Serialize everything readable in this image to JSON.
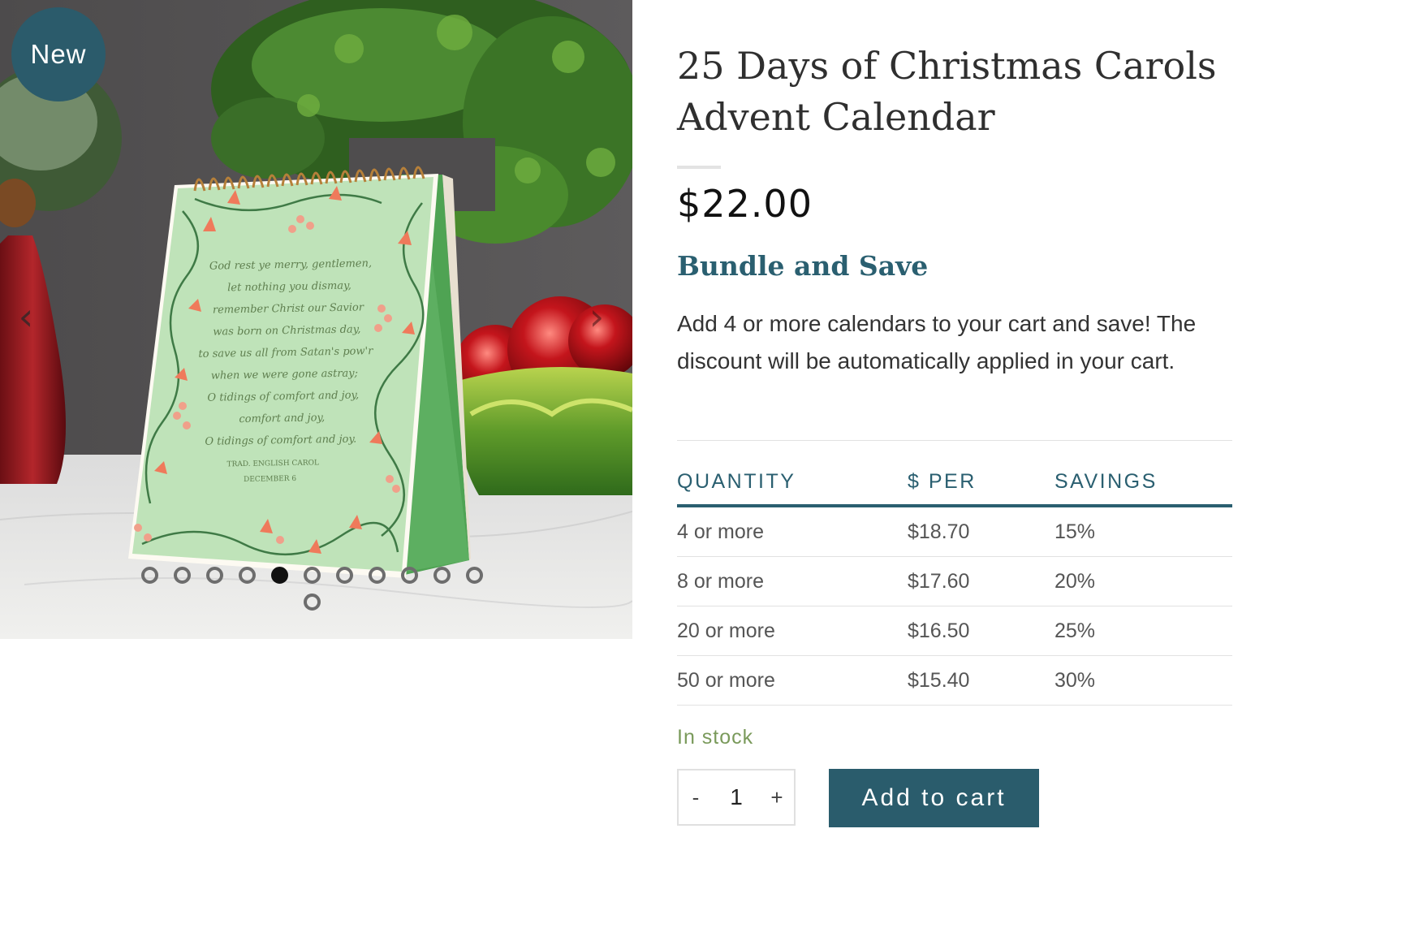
{
  "gallery": {
    "badge": "New",
    "prev_icon": "chevron-left-icon",
    "next_icon": "chevron-right-icon",
    "dot_count": 12,
    "active_dot_index": 4,
    "card_text": {
      "lines": [
        "God rest ye merry, gentlemen,",
        "let nothing you dismay,",
        "remember Christ our Savior",
        "was born on Christmas day,",
        "to save us all from Satan's pow'r",
        "when we were gone astray;",
        "O tidings of comfort and joy,",
        "comfort and joy,",
        "O tidings of comfort and joy."
      ],
      "attribution": "TRAD. ENGLISH CAROL",
      "date": "DECEMBER 6"
    }
  },
  "product": {
    "title": "25 Days of Christmas Carols Advent Calendar",
    "price": "$22.00",
    "bundle_heading": "Bundle and Save",
    "bundle_text": "Add 4 or more calendars to your cart and save! The discount will be automatically applied in your cart.",
    "stock": "In stock"
  },
  "tiers": {
    "headers": [
      "QUANTITY",
      "$ PER",
      "SAVINGS"
    ],
    "rows": [
      [
        "4 or more",
        "$18.70",
        "15%"
      ],
      [
        "8 or more",
        "$17.60",
        "20%"
      ],
      [
        "20 or more",
        "$16.50",
        "25%"
      ],
      [
        "50 or more",
        "$15.40",
        "30%"
      ]
    ]
  },
  "cart": {
    "minus": "-",
    "plus": "+",
    "quantity": "1",
    "add_label": "Add to cart"
  },
  "colors": {
    "accent": "#2a5f70",
    "button": "#2a5c6c",
    "stock": "#7a9a5b",
    "card": "#bfe3b9"
  }
}
